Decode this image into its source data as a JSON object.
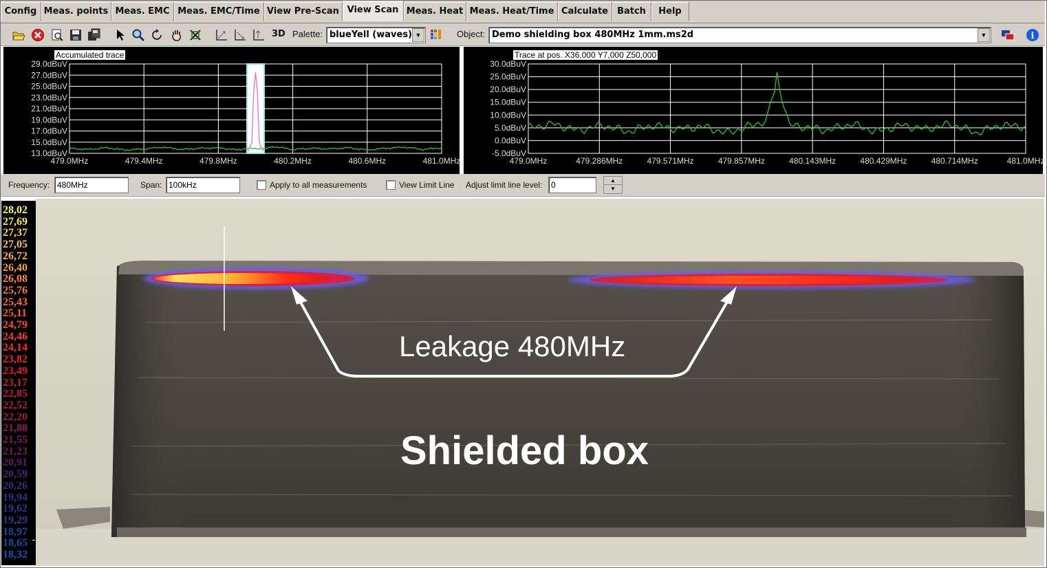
{
  "menu": {
    "tabs": [
      {
        "label": "Config",
        "active": false
      },
      {
        "label": "Meas. points",
        "active": false
      },
      {
        "label": "Meas. EMC",
        "active": false
      },
      {
        "label": "Meas. EMC/Time",
        "active": false
      },
      {
        "label": "View Pre-Scan",
        "active": false
      },
      {
        "label": "View Scan",
        "active": true
      },
      {
        "label": "Meas. Heat",
        "active": false
      },
      {
        "label": "Meas. Heat/Time",
        "active": false
      },
      {
        "label": "Calculate",
        "active": false
      },
      {
        "label": "Batch",
        "active": false
      },
      {
        "label": "Help",
        "active": false
      }
    ]
  },
  "toolbar": {
    "icons": [
      "open-folder-icon",
      "stop-icon",
      "print-preview-icon",
      "save-icon",
      "copy-icon",
      "pointer-icon",
      "zoom-icon",
      "rotate-icon",
      "pan-hand-icon",
      "reset-view-icon",
      "axis-icon-1",
      "axis-icon-2",
      "axis-icon-3"
    ],
    "view3d_label": "3D",
    "palette_label": "Palette:",
    "palette_value": "blueYell (waves)",
    "object_label": "Object:",
    "object_value": "Demo shielding box 480MHz 1mm.ms2d"
  },
  "chart_data": [
    {
      "type": "line",
      "title": "Accumulated trace",
      "y_ticks": [
        "29.0dBuV",
        "27.0dBuV",
        "25.0dBuV",
        "23.0dBuV",
        "21.0dBuV",
        "19.0dBuV",
        "17.0dBuV",
        "15.0dBuV",
        "13.0dBuV"
      ],
      "ylim": [
        13,
        29
      ],
      "x_ticks": [
        "479.0MHz",
        "479.4MHz",
        "479.8MHz",
        "480.2MHz",
        "480.6MHz",
        "481.0MHz"
      ],
      "xlim": [
        479.0,
        481.0
      ],
      "grid": true,
      "highlight_range_mhz": [
        479.95,
        480.05
      ],
      "series": [
        {
          "color": "#22cc22",
          "x": [
            479.0,
            479.1,
            479.2,
            479.3,
            479.4,
            479.5,
            479.6,
            479.7,
            479.8,
            479.9,
            479.95,
            480.05,
            480.1,
            480.2,
            480.3,
            480.4,
            480.5,
            480.6,
            480.7,
            480.8,
            480.9,
            481.0
          ],
          "y": [
            13.9,
            13.7,
            14.0,
            13.6,
            13.8,
            14.1,
            13.7,
            13.9,
            14.0,
            13.6,
            13.8,
            13.9,
            14.2,
            13.7,
            13.9,
            13.8,
            14.0,
            13.6,
            13.9,
            14.1,
            13.7,
            14.0
          ]
        },
        {
          "color": "#e070e0",
          "x": [
            479.96,
            479.98,
            479.99,
            480.0,
            480.01,
            480.02,
            480.04
          ],
          "y": [
            13.4,
            15.0,
            24.0,
            27.5,
            24.0,
            15.0,
            13.4
          ]
        }
      ]
    },
    {
      "type": "line",
      "title": "Trace at pos. X36,000 Y7,000 Z50,000",
      "y_ticks": [
        "30.0dBuV",
        "25.0dBuV",
        "20.0dBuV",
        "15.0dBuV",
        "10.0dBuV",
        "5.0dBuV",
        "0.0dBuV",
        "-5.0dBuV"
      ],
      "ylim": [
        -5,
        30
      ],
      "x_ticks": [
        "479.0MHz",
        "479.286MHz",
        "479.571MHz",
        "479.857MHz",
        "480.143MHz",
        "480.429MHz",
        "480.714MHz",
        "481.0MHz"
      ],
      "xlim": [
        479.0,
        481.0
      ],
      "grid": true,
      "series": [
        {
          "color": "#22cc22",
          "x": [
            479.0,
            479.1,
            479.2,
            479.3,
            479.4,
            479.5,
            479.6,
            479.7,
            479.8,
            479.9,
            479.95,
            479.98,
            480.0,
            480.02,
            480.05,
            480.1,
            480.2,
            480.3,
            480.4,
            480.5,
            480.6,
            480.7,
            480.8,
            480.9,
            481.0
          ],
          "y": [
            5.0,
            6.5,
            4.0,
            6.0,
            3.5,
            6.0,
            4.5,
            5.5,
            3.0,
            6.0,
            7.5,
            15.0,
            26.0,
            15.0,
            6.0,
            5.5,
            4.0,
            6.5,
            3.5,
            6.0,
            4.5,
            6.5,
            3.0,
            6.0,
            5.5
          ]
        }
      ]
    }
  ],
  "controls": {
    "frequency_label": "Frequency:",
    "frequency_value": "480MHz",
    "span_label": "Span:",
    "span_value": "100kHz",
    "apply_all_label": "Apply to all measurements",
    "view_limit_label": "View Limit Line",
    "adjust_limit_label": "Adjust limit line level:",
    "limit_value": "0"
  },
  "scale": {
    "values": [
      "28,02",
      "27,69",
      "27,37",
      "27,05",
      "26,72",
      "26,40",
      "26,08",
      "25,76",
      "25,43",
      "25,11",
      "24,79",
      "24,46",
      "24,14",
      "23,82",
      "23,49",
      "23,17",
      "22,85",
      "22,52",
      "22,20",
      "21,88",
      "21,55",
      "21,23",
      "20,91",
      "20,59",
      "20,26",
      "19,94",
      "19,62",
      "19,29",
      "18,97",
      "18,65",
      "18,32"
    ],
    "colors": [
      "#ffff40",
      "#ffec40",
      "#ffd840",
      "#ffc440",
      "#ffb040",
      "#ff9c30",
      "#ff8830",
      "#ff7830",
      "#ff6830",
      "#ff5830",
      "#ff4828",
      "#ff3828",
      "#ff2828",
      "#f01e28",
      "#e01a30",
      "#d01838",
      "#c01840",
      "#b01848",
      "#a01850",
      "#901858",
      "#801860",
      "#701868",
      "#601870",
      "#502078",
      "#402880",
      "#303088",
      "#283890",
      "#204098",
      "#1848a0",
      "#1050a8",
      "#0858b0"
    ]
  },
  "overlay": {
    "leak_label": "Leakage 480MHz",
    "box_label": "Shielded box"
  }
}
